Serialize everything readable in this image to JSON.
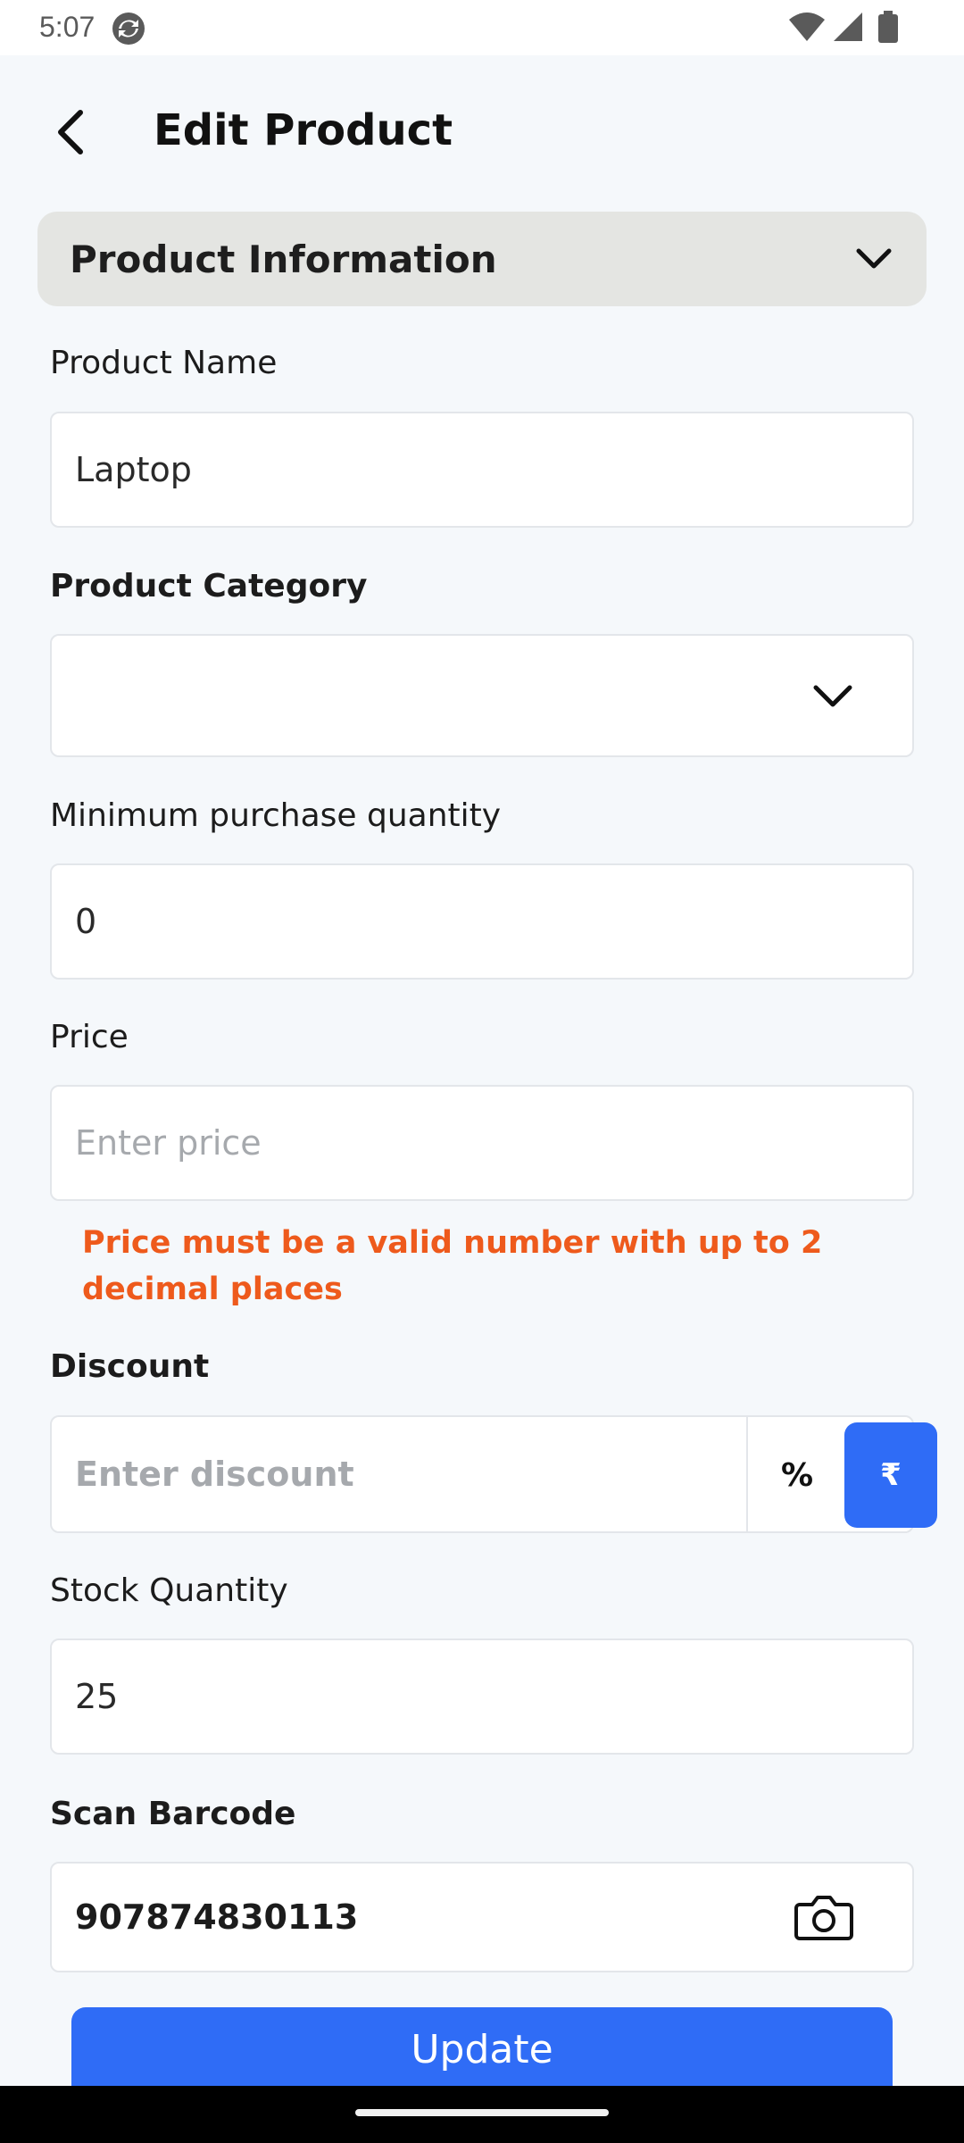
{
  "status_bar": {
    "time": "5:07",
    "icons": [
      "sync-icon",
      "wifi-icon",
      "signal-icon",
      "battery-icon"
    ]
  },
  "header": {
    "title": "Edit Product",
    "back_icon": "chevron-left-icon"
  },
  "section": {
    "title": "Product Information",
    "expanded": true,
    "chevron_icon": "chevron-down-icon"
  },
  "form": {
    "product_name": {
      "label": "Product Name",
      "value": "Laptop"
    },
    "product_category": {
      "label": "Product Category",
      "value": ""
    },
    "min_purchase_qty": {
      "label": "Minimum purchase quantity",
      "value": "0"
    },
    "price": {
      "label": "Price",
      "placeholder": "Enter price",
      "value": "",
      "error": "Price must be a valid number with up to 2 decimal places"
    },
    "discount": {
      "label": "Discount",
      "placeholder": "Enter discount",
      "value": "",
      "percent_label": "%",
      "rupee_label": "₹",
      "selected_type": "₹"
    },
    "stock_quantity": {
      "label": "Stock Quantity",
      "value": "25"
    },
    "barcode": {
      "label": "Scan Barcode",
      "value": "907874830113",
      "icon": "camera-icon"
    }
  },
  "actions": {
    "update_label": "Update"
  },
  "colors": {
    "accent": "#2f6cf6",
    "error": "#ee5a1c",
    "background": "#f5f8fb",
    "section_bg": "#e4e5e2"
  }
}
